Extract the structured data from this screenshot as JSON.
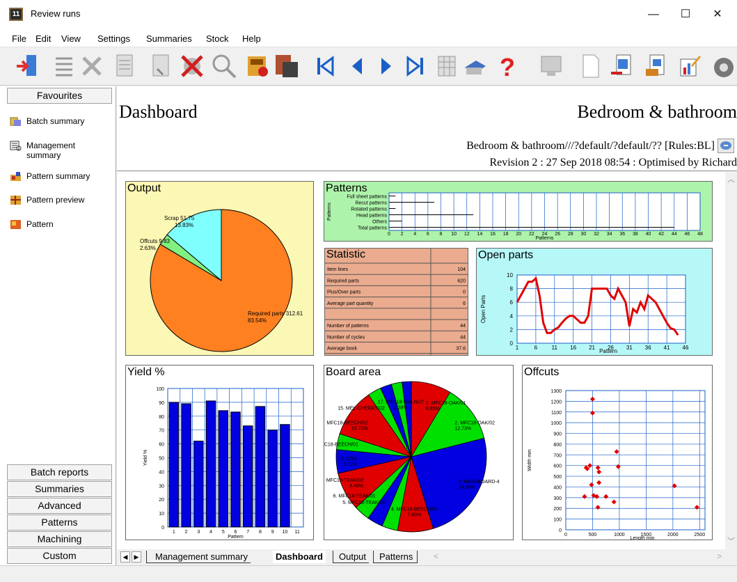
{
  "window": {
    "title": "Review runs",
    "app_icon_text": "11",
    "minimize": "—",
    "maximize": "☐",
    "close": "✕"
  },
  "menu": [
    "File",
    "Edit",
    "View",
    "Settings",
    "Summaries",
    "Stock",
    "Help"
  ],
  "toolbar_icons": [
    "exit-icon",
    "list-icon",
    "delete-icon",
    "batch-icon",
    "batch-alt-icon",
    "tools-icon",
    "magnify-icon",
    "report-icon",
    "stack-icon",
    "first-record-icon",
    "previous-record-icon",
    "next-record-icon",
    "last-record-icon",
    "grid-icon",
    "print-icon",
    "help-icon",
    "monitor-icon",
    "page-icon",
    "export-icon",
    "save-icon",
    "chart-edit-icon",
    "settings-icon"
  ],
  "sidebar": {
    "favourites": "Favourites",
    "items": [
      {
        "label": "Batch summary",
        "icon": "batch-summary-icon"
      },
      {
        "label": "Management summary",
        "icon": "management-summary-icon"
      },
      {
        "label": "Pattern summary",
        "icon": "pattern-summary-icon"
      },
      {
        "label": "Pattern preview",
        "icon": "pattern-preview-icon"
      },
      {
        "label": "Pattern",
        "icon": "pattern-icon"
      }
    ],
    "sections": [
      "Batch reports",
      "Summaries",
      "Advanced",
      "Patterns",
      "Machining",
      "Custom"
    ]
  },
  "dashboard": {
    "title": "Dashboard",
    "right_title": "Bedroom & bathroom",
    "subtitle1": "Bedroom & bathroom///?default/?default/?? [Rules:BL]",
    "subtitle2": "Revision 2 : 27 Sep 2018 08:54 : Optimised by Richard"
  },
  "statistic": {
    "title": "Statistic",
    "rows": [
      {
        "label": "Item lines",
        "value": "104"
      },
      {
        "label": "Required parts",
        "value": "620"
      },
      {
        "label": "Plus/Over parts",
        "value": "0"
      },
      {
        "label": "Average part quantity",
        "value": "6"
      },
      {
        "label": "",
        "value": ""
      },
      {
        "label": "Number of patterns",
        "value": "44"
      },
      {
        "label": "Number of cycles",
        "value": "44"
      },
      {
        "label": "Average book",
        "value": "37.6"
      }
    ]
  },
  "tabs": [
    "Management summary",
    "Dashboard",
    "Output",
    "Patterns"
  ],
  "active_tab": "Dashboard",
  "colors": {
    "output_bg": "#fbf7b4",
    "patterns_bg": "#aef3ab",
    "statistic_bg": "#eaab8e",
    "openparts_bg": "#b6f8f8",
    "series_red": "#e00000",
    "series_blue": "#0000e0",
    "pie_orange": "#ff8020",
    "pie_cyan": "#80ffff",
    "pie_green": "#80f080"
  },
  "chart_data": [
    {
      "type": "pie",
      "title": "Output",
      "slices": [
        {
          "name": "Required parts",
          "value": 312.61,
          "percent": "83.54%",
          "label": "Required parts 312.61",
          "color": "#ff8020"
        },
        {
          "name": "Offcuts",
          "value": 9.83,
          "percent": "2.63%",
          "label": "Offcuts 9.83",
          "color": "#80f080"
        },
        {
          "name": "Scrap",
          "value": 51.75,
          "percent": "13.83%",
          "label": "Scrap 51.75",
          "color": "#80ffff"
        }
      ]
    },
    {
      "type": "bar",
      "orientation": "horizontal",
      "title": "Patterns",
      "xlabel": "Patterns",
      "ylabel": "Patterns",
      "categories": [
        "Full sheet patterns",
        "Recut patterns",
        "Rotated patterns",
        "Head patterns",
        "Others",
        "Total patterns"
      ],
      "values": [
        1,
        7,
        1,
        13,
        2,
        44
      ],
      "xlim": [
        0,
        48
      ],
      "xticks": [
        "0",
        "2",
        "4",
        "6",
        "8",
        "10",
        "12",
        "14",
        "16",
        "18",
        "20",
        "22",
        "24",
        "26",
        "28",
        "30",
        "32",
        "34",
        "36",
        "38",
        "40",
        "42",
        "44",
        "46",
        "48"
      ]
    },
    {
      "type": "line",
      "title": "Open parts",
      "xlabel": "Pattern",
      "ylabel": "Open Parts",
      "ylim": [
        0,
        10
      ],
      "xticks": [
        "1",
        "6",
        "11",
        "16",
        "21",
        "26",
        "31",
        "36",
        "41",
        "46"
      ],
      "yticks": [
        "0",
        "2",
        "4",
        "6",
        "8",
        "10"
      ],
      "x": [
        1,
        2,
        3,
        4,
        5,
        6,
        7,
        8,
        9,
        10,
        11,
        12,
        13,
        14,
        15,
        16,
        17,
        18,
        19,
        20,
        21,
        22,
        23,
        24,
        25,
        26,
        27,
        28,
        29,
        30,
        31,
        32,
        33,
        34,
        35,
        36,
        37,
        38,
        39,
        40,
        41,
        42,
        43,
        44
      ],
      "y": [
        6,
        7,
        8,
        9,
        9,
        9.5,
        7,
        3,
        1.5,
        1.5,
        2,
        2.3,
        3,
        3.6,
        4,
        4,
        3.5,
        3,
        3,
        4,
        8,
        8,
        8,
        8,
        8,
        7,
        6.5,
        8,
        7,
        6,
        2.5,
        5,
        4.5,
        6,
        5,
        7,
        6.5,
        6,
        5,
        4,
        3,
        2.2,
        2,
        1.2
      ]
    },
    {
      "type": "bar",
      "title": "Yield %",
      "ylabel": "Yield %",
      "xlabel": "Pattern",
      "ylim": [
        0,
        100
      ],
      "categories": [
        "1",
        "2",
        "3",
        "4",
        "5",
        "6",
        "7",
        "8",
        "9",
        "10",
        "11"
      ],
      "values": [
        90,
        89,
        62,
        91,
        84,
        83,
        73,
        87,
        70,
        74
      ],
      "yticks": [
        "0",
        "10",
        "20",
        "30",
        "40",
        "50",
        "60",
        "70",
        "80",
        "90",
        "100"
      ]
    },
    {
      "type": "pie",
      "title": "Board area",
      "slices": [
        {
          "label": "1. MFC18-OAK/01",
          "percent": "8.85%",
          "value": 8.85,
          "color": "#e00000"
        },
        {
          "label": "2. MFC18-OAK/02",
          "percent": "12.73%",
          "value": 12.73,
          "color": "#00e000"
        },
        {
          "label": "3. HARDBOARD-4",
          "percent": "24.88%",
          "value": 24.88,
          "color": "#0000e0"
        },
        {
          "label": "4. MFC18-BEECH/01",
          "percent": "7.85%",
          "value": 7.85,
          "color": "#e00000"
        },
        {
          "label": "",
          "percent": "",
          "value": 3.5,
          "color": "#00e000"
        },
        {
          "label": "5. MFC18-TEAK/02",
          "percent": "",
          "value": 3.5,
          "color": "#0000e0"
        },
        {
          "label": "6. MFC18-TEAK/01",
          "percent": "",
          "value": 3.5,
          "color": "#00e000"
        },
        {
          "label": "MFC18-TEAK/02",
          "percent": "8.48%",
          "value": 8.48,
          "color": "#e00000"
        },
        {
          "label": "0. X001",
          "percent": "5.21%",
          "value": 5.21,
          "color": "#0000e0"
        },
        {
          "label": "C18-BEECH/01",
          "percent": "",
          "value": 3.5,
          "color": "#00e000"
        },
        {
          "label": "MFC18-BEECH/02",
          "percent": "10.70%",
          "value": 10.7,
          "color": "#e00000"
        },
        {
          "label": "15. MEL-CHERRY/02",
          "percent": "",
          "value": 3,
          "color": "#00e000"
        },
        {
          "label": "",
          "percent": "",
          "value": 2.5,
          "color": "#0000e0"
        },
        {
          "label": "17. MFC18-WALNUT",
          "percent": "2.39%",
          "value": 2.39,
          "color": "#00e000"
        },
        {
          "label": "",
          "percent": "",
          "value": 2,
          "color": "#0000e0"
        }
      ]
    },
    {
      "type": "scatter",
      "title": "Offcuts",
      "xlabel": "Length mm",
      "ylabel": "Width mm",
      "xlim": [
        0,
        2600
      ],
      "ylim": [
        0,
        1300
      ],
      "xticks": [
        "0",
        "500",
        "1000",
        "1500",
        "2000",
        "2500"
      ],
      "yticks": [
        "0",
        "100",
        "200",
        "300",
        "400",
        "500",
        "600",
        "700",
        "800",
        "900",
        "1000",
        "1100",
        "1200",
        "1300"
      ],
      "points": [
        [
          500,
          1220
        ],
        [
          500,
          1090
        ],
        [
          380,
          580
        ],
        [
          400,
          570
        ],
        [
          450,
          600
        ],
        [
          600,
          580
        ],
        [
          620,
          540
        ],
        [
          620,
          440
        ],
        [
          950,
          730
        ],
        [
          980,
          590
        ],
        [
          480,
          420
        ],
        [
          350,
          310
        ],
        [
          520,
          320
        ],
        [
          580,
          310
        ],
        [
          750,
          310
        ],
        [
          900,
          260
        ],
        [
          600,
          210
        ],
        [
          2030,
          410
        ],
        [
          2450,
          210
        ]
      ]
    }
  ]
}
